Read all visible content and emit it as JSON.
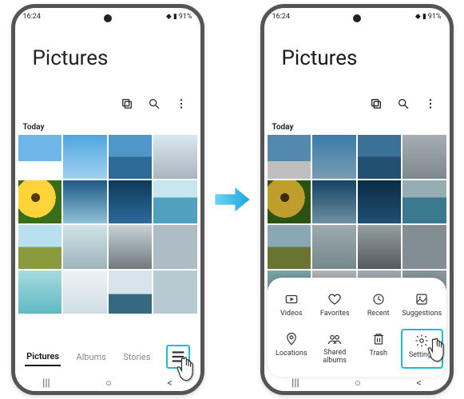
{
  "status": {
    "time": "16:24",
    "battery": "91%"
  },
  "app": {
    "title": "Pictures",
    "section": "Today"
  },
  "tabs": {
    "pictures": "Pictures",
    "albums": "Albums",
    "stories": "Stories"
  },
  "sheet": {
    "videos": "Videos",
    "favorites": "Favorites",
    "recent": "Recent",
    "suggestions": "Suggestions",
    "locations": "Locations",
    "shared": "Shared albums",
    "trash": "Trash",
    "settings": "Settings"
  }
}
